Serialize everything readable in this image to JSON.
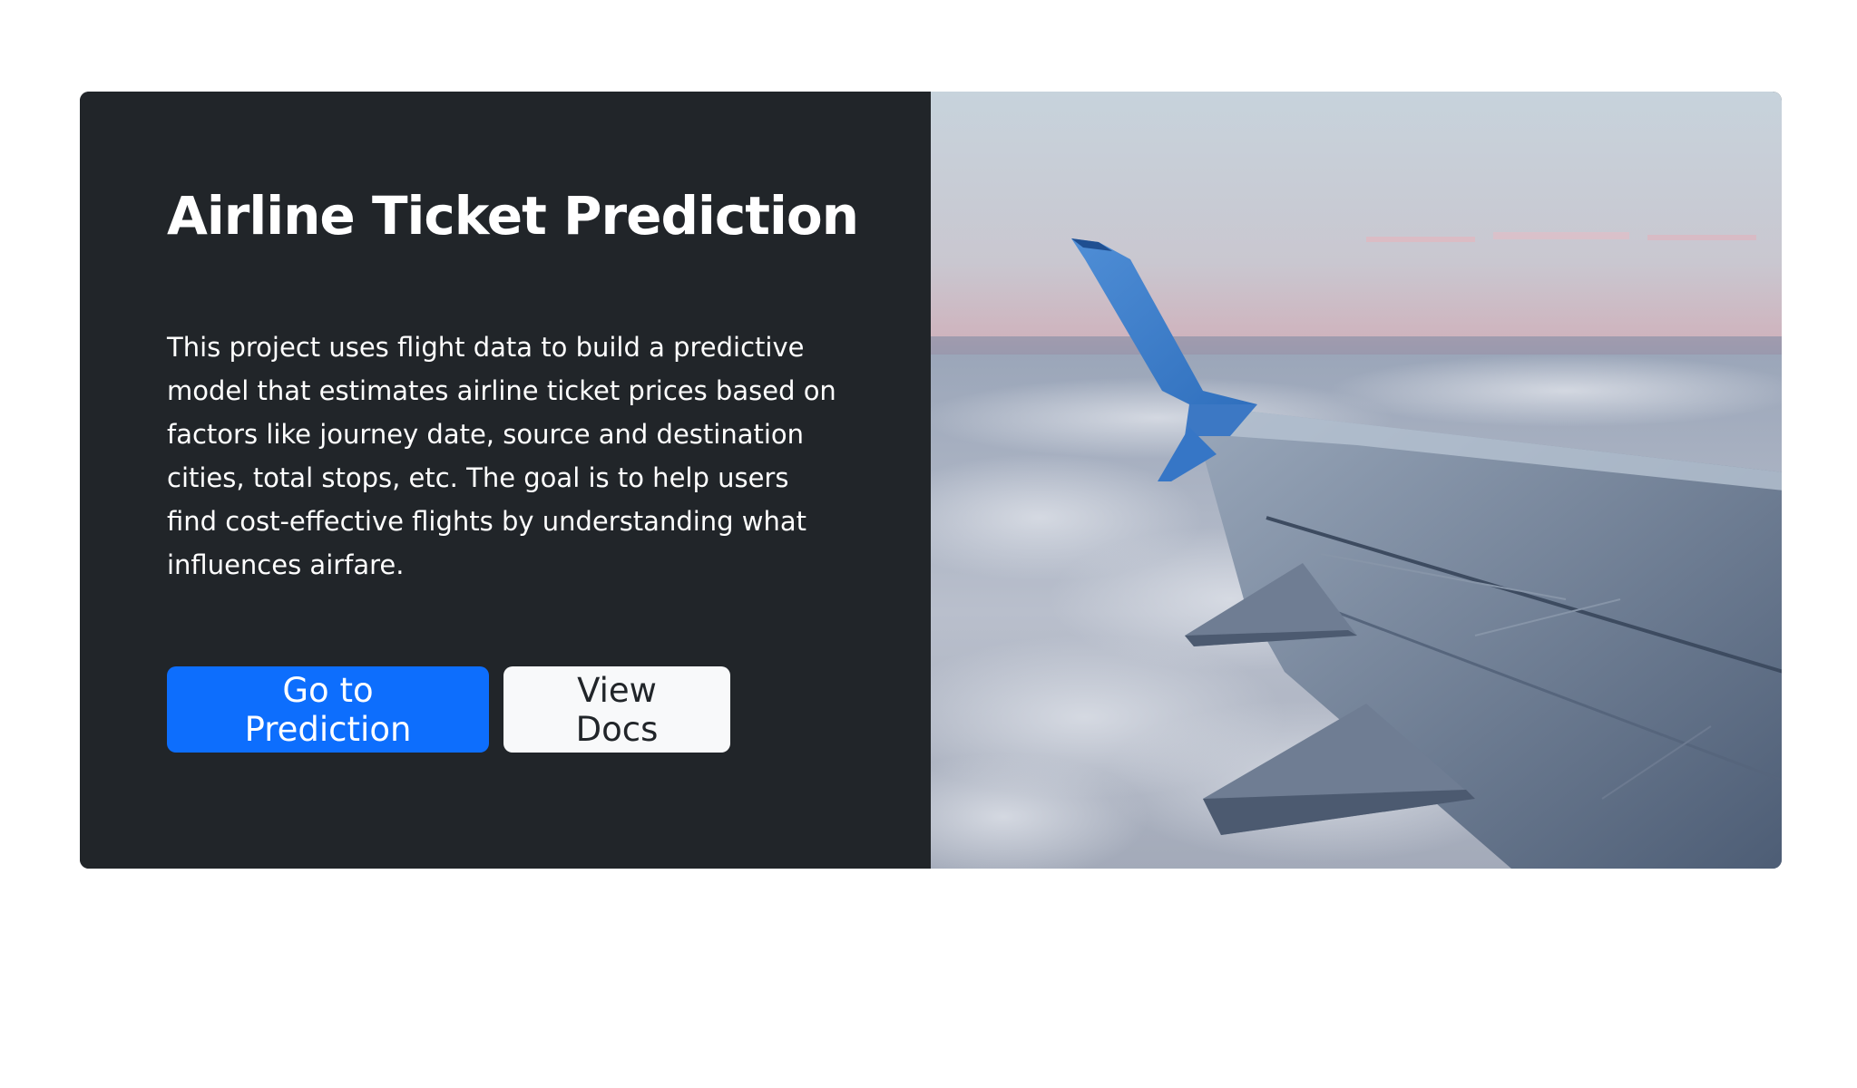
{
  "hero": {
    "title": "Airline Ticket Prediction",
    "description": "This project uses flight data to build a predictive model that estimates airline ticket prices based on factors like journey date, source and destination cities, total stops, etc. The goal is to help users find cost-effective flights by understanding what influences airfare.",
    "buttons": {
      "primary_label": "Go to Prediction",
      "secondary_label": "View Docs"
    },
    "image": {
      "subject": "airplane-wing-over-clouds"
    }
  },
  "colors": {
    "panel_bg": "#212529",
    "primary_button": "#0d6efd",
    "light_button": "#f8f9fa",
    "page_bg": "#ffffff"
  }
}
